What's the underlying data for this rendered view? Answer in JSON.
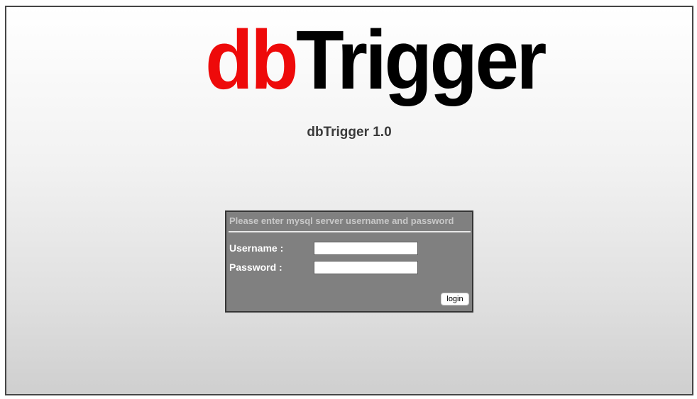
{
  "logo": {
    "part1": "db",
    "part2": "Trigger"
  },
  "version_title": "dbTrigger 1.0",
  "login": {
    "header": "Please enter mysql server username and password",
    "username_label": "Username :",
    "username_value": "",
    "password_label": "Password :",
    "password_value": "",
    "button_label": "login"
  },
  "colors": {
    "logo_db": "#ee0a0a",
    "logo_trigger": "#000000",
    "login_panel": "#808080"
  }
}
